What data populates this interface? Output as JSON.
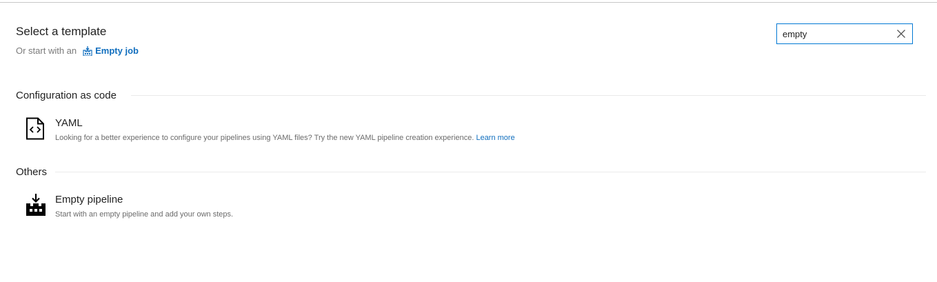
{
  "header": {
    "title": "Select a template",
    "subtitle_prefix": "Or start with an",
    "empty_job_label": "Empty job"
  },
  "search": {
    "value": "empty",
    "clear_icon": "close-icon"
  },
  "sections": [
    {
      "label": "Configuration as code",
      "items": [
        {
          "title": "YAML",
          "description": "Looking for a better experience to configure your pipelines using YAML files? Try the new YAML pipeline creation experience.",
          "link": "Learn more",
          "icon": "yaml-file-icon"
        }
      ]
    },
    {
      "label": "Others",
      "items": [
        {
          "title": "Empty pipeline",
          "description": "Start with an empty pipeline and add your own steps.",
          "icon": "empty-pipeline-icon"
        }
      ]
    }
  ],
  "colors": {
    "accent": "#0078d4",
    "link": "#106ebe",
    "text": "#212121",
    "muted": "#6b6b6b"
  }
}
